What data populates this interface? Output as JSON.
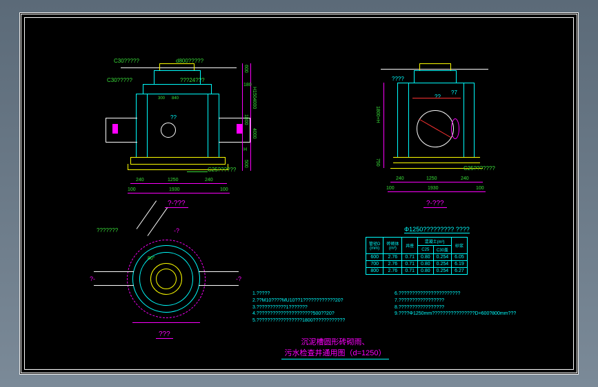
{
  "title": {
    "line1": "沉泥槽圆形砖砌雨、",
    "line2": "污水检查井通用图（d=1250）"
  },
  "sectionA": {
    "label": "?-???",
    "c30a": "C30?????",
    "c30b": "C30?????",
    "d800": "d800?????",
    "q24": "???24???",
    "q300": "300",
    "q840": "840",
    "qq": "??",
    "c25": "C25??????",
    "dims": {
      "w240a": "240",
      "w1250": "1250",
      "w240b": "240",
      "w100a": "100",
      "w1930": "1930",
      "w100b": "100",
      "h500": "500",
      "hH": "H",
      "h1800": "1800",
      "h180": "180",
      "h600": "600",
      "hH1504000": "H1504000",
      "h4000": "4000"
    }
  },
  "sectionB": {
    "label": "?-???",
    "qqq": "????",
    "qq": "??",
    "q7": "?7",
    "c25": "C25???????",
    "dims": {
      "w240a": "240",
      "w1250": "1250",
      "w240b": "240",
      "w100a": "100",
      "w1930": "1930",
      "w100b": "100",
      "h1800H": "1800+H",
      "h750": "750"
    }
  },
  "planView": {
    "label": "???",
    "a80": "80°",
    "qqqq": "???????",
    "b": "-?",
    "bb": "?-",
    "bbc": "-?"
  },
  "table": {
    "title": "Φ1250????????? ????",
    "header": {
      "col1": "管径D",
      "col2": "砖砌体",
      "col3": "井座",
      "col4": "混凝土(m³)",
      "col5": "C25",
      "col6": "C30盖",
      "col7": "砂浆"
    },
    "subheader": {
      "s1": "(mm)",
      "s2": "(m³)",
      "s3": "井座"
    },
    "rows": [
      {
        "d": "600",
        "brick": "2.76",
        "seat": "0.71",
        "c25a": "0.80",
        "c25b": "0.254",
        "c30": "6.05"
      },
      {
        "d": "700",
        "brick": "2.76",
        "seat": "0.71",
        "c25a": "0.80",
        "c25b": "0.254",
        "c30": "6.19"
      },
      {
        "d": "800",
        "brick": "2.76",
        "seat": "0.71",
        "c25a": "0.80",
        "c25b": "0.254",
        "c30": "6.27"
      }
    ]
  },
  "notes": {
    "n1": "1.?????",
    "n2": "2.??M10????MU10??1????????????20?",
    "n3": "3.???????????1???????",
    "n4": "4.?????????????????????500??20?",
    "n5": "5.?????????????????1800????????????",
    "n6": "6.???????????????????????",
    "n7": "7.?????????????????",
    "n8": "8.?????????????????",
    "n9": "9.????Φ1250mm????????????????D=600?800mm???"
  },
  "sectionC": {
    "label": "?-???"
  }
}
